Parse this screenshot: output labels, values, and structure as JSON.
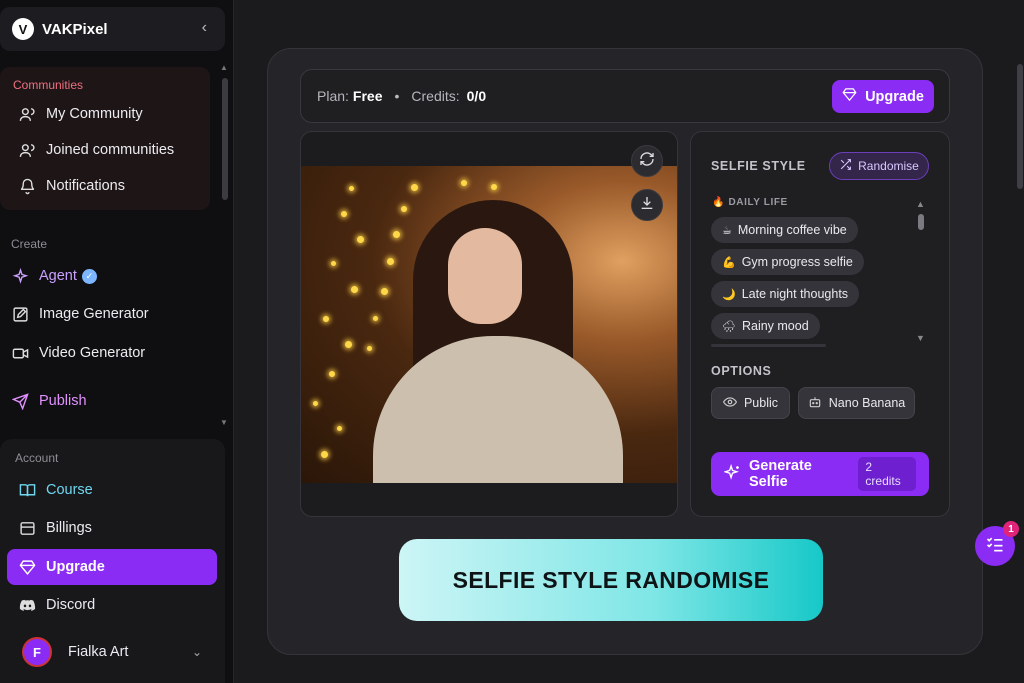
{
  "brand": {
    "name": "VAKPixel",
    "logo": "V"
  },
  "sidebar": {
    "communities_label": "Communities",
    "communities": [
      {
        "label": "My Community",
        "icon": "users-icon"
      },
      {
        "label": "Joined communities",
        "icon": "users-icon"
      },
      {
        "label": "Notifications",
        "icon": "bell-icon"
      }
    ],
    "create_label": "Create",
    "create": [
      {
        "label": "Agent",
        "icon": "sparkles-icon",
        "color": "#c9a0ff"
      },
      {
        "label": "Image Generator",
        "icon": "edit-icon"
      },
      {
        "label": "Video Generator",
        "icon": "video-icon"
      },
      {
        "label": "Publish",
        "icon": "send-icon",
        "color": "#e090ff"
      }
    ],
    "account_label": "Account",
    "account": [
      {
        "label": "Course",
        "icon": "book-icon",
        "color": "#6fd6ee"
      },
      {
        "label": "Billings",
        "icon": "billing-icon"
      },
      {
        "label": "Upgrade",
        "icon": "diamond-icon",
        "active": true
      },
      {
        "label": "Discord",
        "icon": "discord-icon"
      }
    ],
    "user": {
      "initial": "F",
      "name": "Fialka Art"
    }
  },
  "plan_bar": {
    "plan_label": "Plan:",
    "plan_value": "Free",
    "credits_label": "Credits:",
    "credits_value": "0/0",
    "upgrade_label": "Upgrade"
  },
  "style_panel": {
    "title": "SELFIE STYLE",
    "randomise_label": "Randomise",
    "category": "DAILY LIFE",
    "styles": [
      {
        "emoji": "☕",
        "label": "Morning coffee vibe"
      },
      {
        "emoji": "💪",
        "label": "Gym progress selfie"
      },
      {
        "emoji": "🌙",
        "label": "Late night thoughts"
      },
      {
        "emoji": "🌧",
        "label": "Rainy mood"
      }
    ],
    "options_title": "OPTIONS",
    "options": [
      {
        "label": "Public",
        "icon": "eye-icon"
      },
      {
        "label": "Nano Banana",
        "icon": "bot-icon"
      }
    ],
    "generate_label": "Generate Selfie",
    "generate_cost": "2 credits"
  },
  "banner": {
    "text": "SELFIE STYLE RANDOMISE"
  },
  "fab": {
    "badge": "1"
  },
  "colors": {
    "accent": "#8b2cf5",
    "banner_start": "#cdf5f6",
    "banner_end": "#17c8c8"
  }
}
